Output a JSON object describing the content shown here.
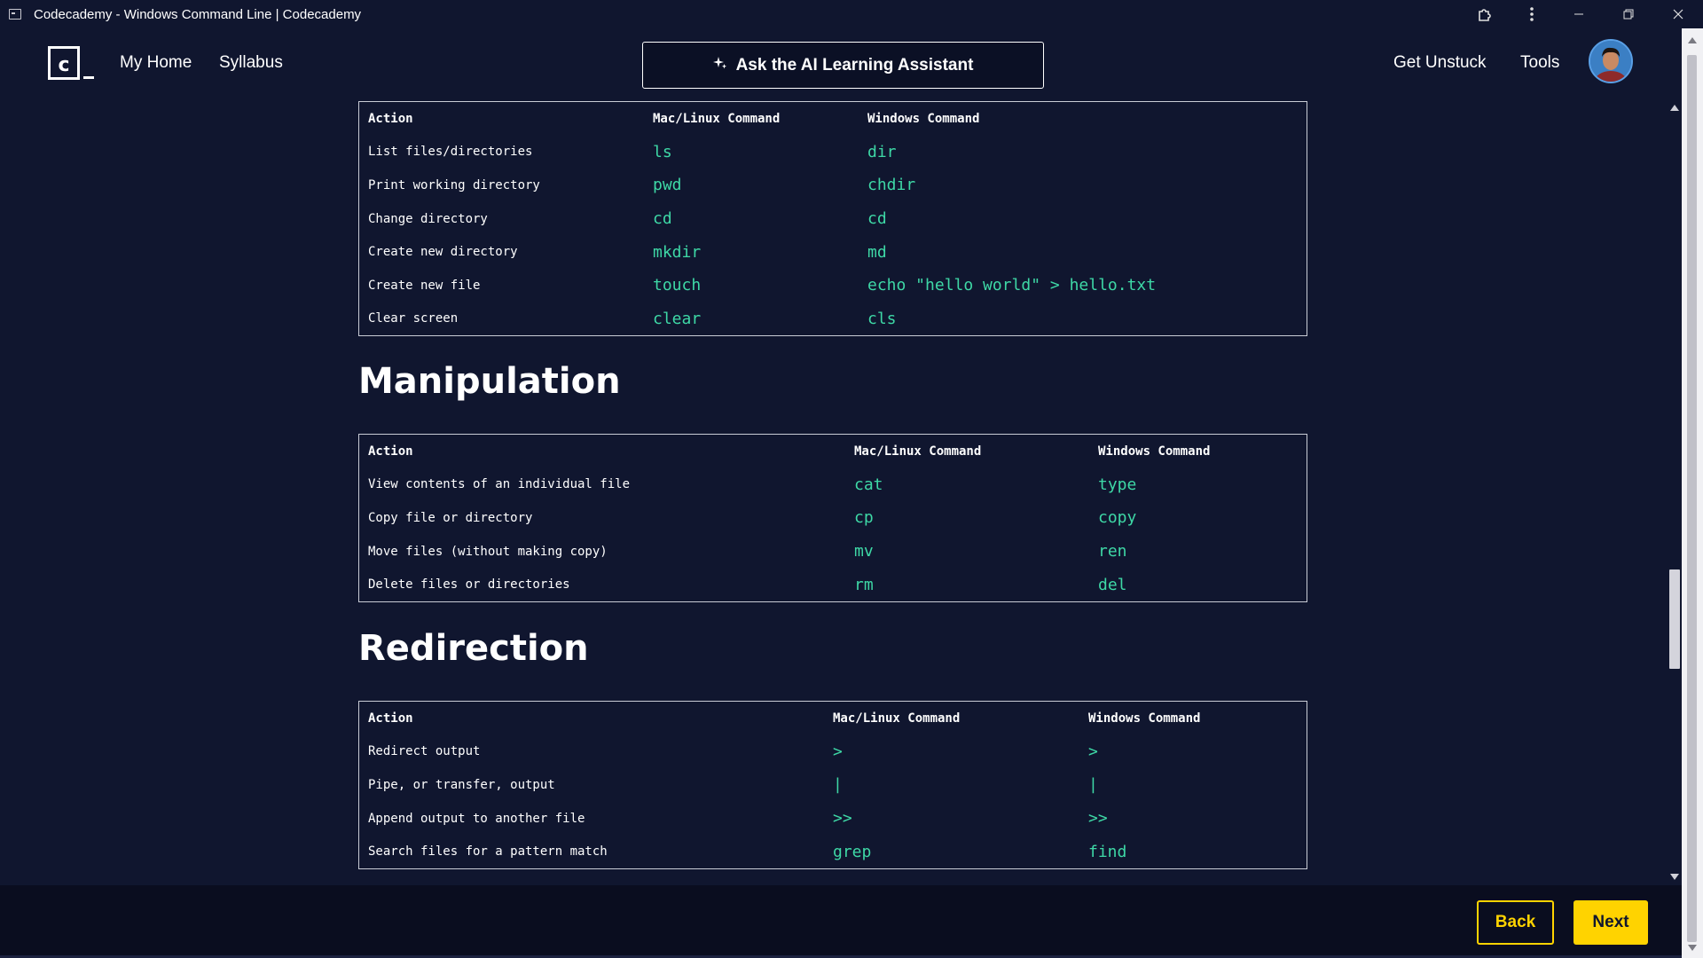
{
  "window": {
    "title": "Codecademy - Windows Command Line | Codecademy"
  },
  "nav": {
    "my_home": "My Home",
    "syllabus": "Syllabus",
    "ai_button": "Ask the AI Learning Assistant",
    "get_unstuck": "Get Unstuck",
    "tools": "Tools",
    "logo_letter": "c"
  },
  "tables": {
    "navigation": {
      "headers": [
        "Action",
        "Mac/Linux Command",
        "Windows Command"
      ],
      "rows": [
        [
          "List files/directories",
          "ls",
          "dir"
        ],
        [
          "Print working directory",
          "pwd",
          "chdir"
        ],
        [
          "Change directory",
          "cd",
          "cd"
        ],
        [
          "Create new directory",
          "mkdir",
          "md"
        ],
        [
          "Create new file",
          "touch",
          "echo \"hello world\" > hello.txt"
        ],
        [
          "Clear screen",
          "clear",
          "cls"
        ]
      ]
    },
    "manipulation": {
      "title": "Manipulation",
      "headers": [
        "Action",
        "Mac/Linux Command",
        "Windows Command"
      ],
      "rows": [
        [
          "View contents of an individual file",
          "cat",
          "type"
        ],
        [
          "Copy file or directory",
          "cp",
          "copy"
        ],
        [
          "Move files (without making copy)",
          "mv",
          "ren"
        ],
        [
          "Delete files or directories",
          "rm",
          "del"
        ]
      ]
    },
    "redirection": {
      "title": "Redirection",
      "headers": [
        "Action",
        "Mac/Linux Command",
        "Windows Command"
      ],
      "rows": [
        [
          "Redirect output",
          ">",
          ">"
        ],
        [
          "Pipe, or transfer, output",
          "|",
          "|"
        ],
        [
          "Append output to another file",
          ">>",
          ">>"
        ],
        [
          "Search files for a pattern match",
          "grep",
          "find"
        ]
      ]
    }
  },
  "footer": {
    "back": "Back",
    "next": "Next"
  },
  "colors": {
    "background": "#10162f",
    "code_green": "#3ed8a6",
    "accent_yellow": "#ffd300"
  }
}
